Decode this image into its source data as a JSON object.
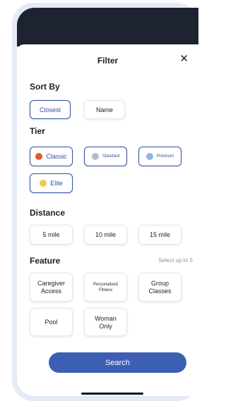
{
  "header": {
    "title": "Filter",
    "close_glyph": "✕"
  },
  "sort_by": {
    "label": "Sort By",
    "options": [
      "Closest",
      "Name"
    ],
    "selected": "Closest"
  },
  "tier": {
    "label": "Tier",
    "options": [
      {
        "label": "Classic",
        "color": "#e45b2a"
      },
      {
        "label": "Standard",
        "color": "#b8bcc6"
      },
      {
        "label": "Premium",
        "color": "#8fb4e8"
      },
      {
        "label": "Elite",
        "color": "#f2c94c"
      }
    ],
    "selected": [
      "Classic",
      "Standard",
      "Premium",
      "Elite"
    ]
  },
  "distance": {
    "label": "Distance",
    "options": [
      "5 mile",
      "10 mile",
      "15 mile"
    ]
  },
  "feature": {
    "label": "Feature",
    "hint": "Select up to 5",
    "options": [
      {
        "line1": "Caregiver",
        "line2": "Access"
      },
      {
        "line1": "Personalized",
        "line2": "Fitness"
      },
      {
        "line1": "Group",
        "line2": "Classes"
      },
      {
        "line1": "Pool",
        "line2": ""
      },
      {
        "line1": "Woman",
        "line2": "Only"
      }
    ]
  },
  "search_button": {
    "label": "Search"
  },
  "colors": {
    "accent": "#2f4fa3",
    "button": "#3d5fb3",
    "status_bar": "#1d2331",
    "frame": "#e4ebf7"
  }
}
